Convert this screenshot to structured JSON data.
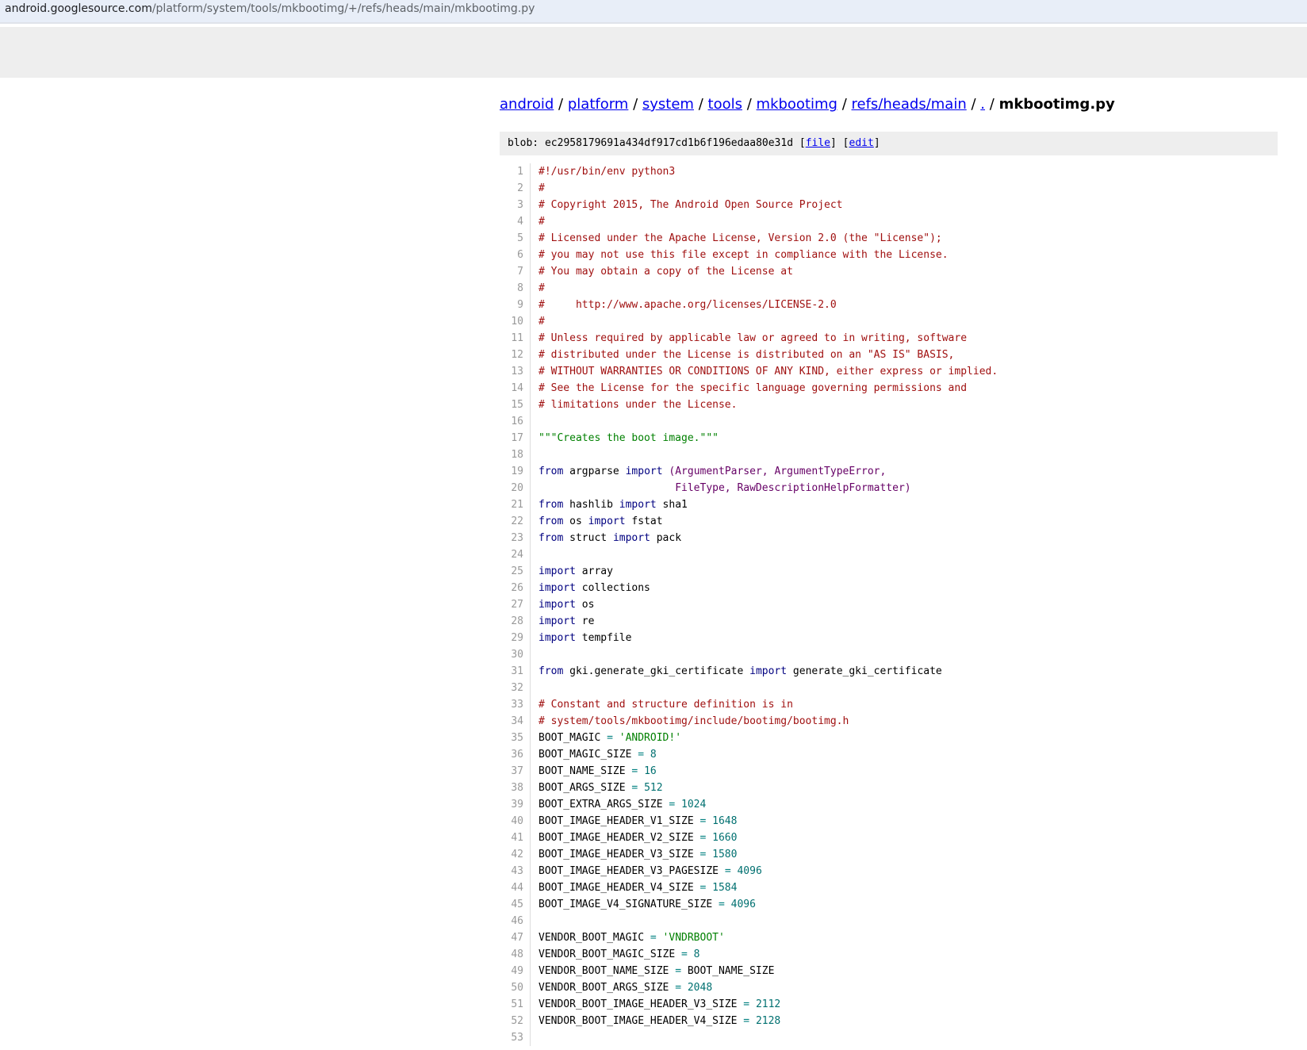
{
  "browser": {
    "url_host": "android.googlesource.com",
    "url_path": "/platform/system/tools/mkbootimg/+/refs/heads/main/mkbootimg.py"
  },
  "breadcrumb": {
    "items": [
      "android",
      "platform",
      "system",
      "tools",
      "mkbootimg",
      "refs/heads/main",
      "."
    ],
    "separator": "/",
    "current": "mkbootimg.py"
  },
  "blob": {
    "label": "blob:",
    "hash": "ec2958179691a434df917cd1b6f196edaa80e31d",
    "file_link": "file",
    "edit_link": "edit"
  },
  "colors": {
    "comment": "#a01010",
    "keyword": "#000080",
    "string": "#008000",
    "number": "#007070",
    "operator": "#008080",
    "line_number": "#999999",
    "header_bg": "#eeeeee"
  },
  "code": {
    "lines": [
      [
        [
          "com",
          "#!/usr/bin/env python3"
        ]
      ],
      [
        [
          "com",
          "#"
        ]
      ],
      [
        [
          "com",
          "# Copyright 2015, The Android Open Source Project"
        ]
      ],
      [
        [
          "com",
          "#"
        ]
      ],
      [
        [
          "com",
          "# Licensed under the Apache License, Version 2.0 (the \"License\");"
        ]
      ],
      [
        [
          "com",
          "# you may not use this file except in compliance with the License."
        ]
      ],
      [
        [
          "com",
          "# You may obtain a copy of the License at"
        ]
      ],
      [
        [
          "com",
          "#"
        ]
      ],
      [
        [
          "com",
          "#     http://www.apache.org/licenses/LICENSE-2.0"
        ]
      ],
      [
        [
          "com",
          "#"
        ]
      ],
      [
        [
          "com",
          "# Unless required by applicable law or agreed to in writing, software"
        ]
      ],
      [
        [
          "com",
          "# distributed under the License is distributed on an \"AS IS\" BASIS,"
        ]
      ],
      [
        [
          "com",
          "# WITHOUT WARRANTIES OR CONDITIONS OF ANY KIND, either express or implied."
        ]
      ],
      [
        [
          "com",
          "# See the License for the specific language governing permissions and"
        ]
      ],
      [
        [
          "com",
          "# limitations under the License."
        ]
      ],
      [],
      [
        [
          "str",
          "\"\"\"Creates the boot image.\"\"\""
        ]
      ],
      [],
      [
        [
          "kwd",
          "from"
        ],
        [
          "src",
          " argparse "
        ],
        [
          "kwd",
          "import"
        ],
        [
          "src",
          " "
        ],
        [
          "pun",
          "(ArgumentParser, ArgumentTypeError,"
        ]
      ],
      [
        [
          "src",
          "                      "
        ],
        [
          "pun",
          "FileType, RawDescriptionHelpFormatter)"
        ]
      ],
      [
        [
          "kwd",
          "from"
        ],
        [
          "src",
          " hashlib "
        ],
        [
          "kwd",
          "import"
        ],
        [
          "src",
          " sha1"
        ]
      ],
      [
        [
          "kwd",
          "from"
        ],
        [
          "src",
          " os "
        ],
        [
          "kwd",
          "import"
        ],
        [
          "src",
          " fstat"
        ]
      ],
      [
        [
          "kwd",
          "from"
        ],
        [
          "src",
          " struct "
        ],
        [
          "kwd",
          "import"
        ],
        [
          "src",
          " pack"
        ]
      ],
      [],
      [
        [
          "kwd",
          "import"
        ],
        [
          "src",
          " array"
        ]
      ],
      [
        [
          "kwd",
          "import"
        ],
        [
          "src",
          " collections"
        ]
      ],
      [
        [
          "kwd",
          "import"
        ],
        [
          "src",
          " os"
        ]
      ],
      [
        [
          "kwd",
          "import"
        ],
        [
          "src",
          " re"
        ]
      ],
      [
        [
          "kwd",
          "import"
        ],
        [
          "src",
          " tempfile"
        ]
      ],
      [],
      [
        [
          "kwd",
          "from"
        ],
        [
          "src",
          " gki.generate_gki_certificate "
        ],
        [
          "kwd",
          "import"
        ],
        [
          "src",
          " generate_gki_certificate"
        ]
      ],
      [],
      [
        [
          "com",
          "# Constant and structure definition is in"
        ]
      ],
      [
        [
          "com",
          "# system/tools/mkbootimg/include/bootimg/bootimg.h"
        ]
      ],
      [
        [
          "src",
          "BOOT_MAGIC "
        ],
        [
          "opr",
          "="
        ],
        [
          "src",
          " "
        ],
        [
          "str",
          "'ANDROID!'"
        ]
      ],
      [
        [
          "src",
          "BOOT_MAGIC_SIZE "
        ],
        [
          "opr",
          "="
        ],
        [
          "src",
          " "
        ],
        [
          "num",
          "8"
        ]
      ],
      [
        [
          "src",
          "BOOT_NAME_SIZE "
        ],
        [
          "opr",
          "="
        ],
        [
          "src",
          " "
        ],
        [
          "num",
          "16"
        ]
      ],
      [
        [
          "src",
          "BOOT_ARGS_SIZE "
        ],
        [
          "opr",
          "="
        ],
        [
          "src",
          " "
        ],
        [
          "num",
          "512"
        ]
      ],
      [
        [
          "src",
          "BOOT_EXTRA_ARGS_SIZE "
        ],
        [
          "opr",
          "="
        ],
        [
          "src",
          " "
        ],
        [
          "num",
          "1024"
        ]
      ],
      [
        [
          "src",
          "BOOT_IMAGE_HEADER_V1_SIZE "
        ],
        [
          "opr",
          "="
        ],
        [
          "src",
          " "
        ],
        [
          "num",
          "1648"
        ]
      ],
      [
        [
          "src",
          "BOOT_IMAGE_HEADER_V2_SIZE "
        ],
        [
          "opr",
          "="
        ],
        [
          "src",
          " "
        ],
        [
          "num",
          "1660"
        ]
      ],
      [
        [
          "src",
          "BOOT_IMAGE_HEADER_V3_SIZE "
        ],
        [
          "opr",
          "="
        ],
        [
          "src",
          " "
        ],
        [
          "num",
          "1580"
        ]
      ],
      [
        [
          "src",
          "BOOT_IMAGE_HEADER_V3_PAGESIZE "
        ],
        [
          "opr",
          "="
        ],
        [
          "src",
          " "
        ],
        [
          "num",
          "4096"
        ]
      ],
      [
        [
          "src",
          "BOOT_IMAGE_HEADER_V4_SIZE "
        ],
        [
          "opr",
          "="
        ],
        [
          "src",
          " "
        ],
        [
          "num",
          "1584"
        ]
      ],
      [
        [
          "src",
          "BOOT_IMAGE_V4_SIGNATURE_SIZE "
        ],
        [
          "opr",
          "="
        ],
        [
          "src",
          " "
        ],
        [
          "num",
          "4096"
        ]
      ],
      [],
      [
        [
          "src",
          "VENDOR_BOOT_MAGIC "
        ],
        [
          "opr",
          "="
        ],
        [
          "src",
          " "
        ],
        [
          "str",
          "'VNDRBOOT'"
        ]
      ],
      [
        [
          "src",
          "VENDOR_BOOT_MAGIC_SIZE "
        ],
        [
          "opr",
          "="
        ],
        [
          "src",
          " "
        ],
        [
          "num",
          "8"
        ]
      ],
      [
        [
          "src",
          "VENDOR_BOOT_NAME_SIZE "
        ],
        [
          "opr",
          "="
        ],
        [
          "src",
          " BOOT_NAME_SIZE"
        ]
      ],
      [
        [
          "src",
          "VENDOR_BOOT_ARGS_SIZE "
        ],
        [
          "opr",
          "="
        ],
        [
          "src",
          " "
        ],
        [
          "num",
          "2048"
        ]
      ],
      [
        [
          "src",
          "VENDOR_BOOT_IMAGE_HEADER_V3_SIZE "
        ],
        [
          "opr",
          "="
        ],
        [
          "src",
          " "
        ],
        [
          "num",
          "2112"
        ]
      ],
      [
        [
          "src",
          "VENDOR_BOOT_IMAGE_HEADER_V4_SIZE "
        ],
        [
          "opr",
          "="
        ],
        [
          "src",
          " "
        ],
        [
          "num",
          "2128"
        ]
      ],
      []
    ]
  }
}
